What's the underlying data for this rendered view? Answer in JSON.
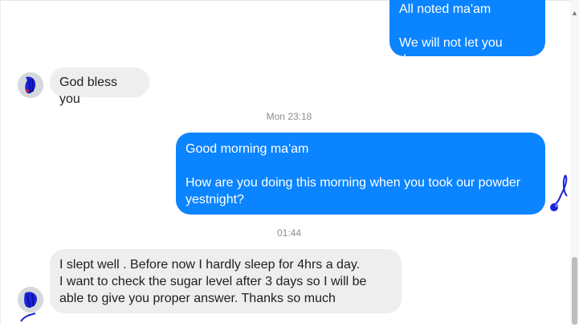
{
  "messages": [
    {
      "text": "All noted ma'am\n\nWe will not let you down"
    },
    {
      "text": "God bless you"
    },
    {
      "timestamp": "Mon 23:18"
    },
    {
      "text": "Good morning ma'am\n\nHow are you doing this morning when you took our powder yestnight?"
    },
    {
      "timestamp": "01:44"
    },
    {
      "text": "I slept well . Before now I hardly sleep for 4hrs a day.\nI want to check the sugar level after 3 days so I will be able to give you proper answer.  Thanks so much"
    }
  ],
  "scrollbar": {
    "up_arrow_icon": "chevron-up-icon"
  },
  "colors": {
    "outgoing_bubble": "#0b84ff",
    "incoming_bubble": "#eeeeee",
    "timestamp": "#8a8d91"
  }
}
